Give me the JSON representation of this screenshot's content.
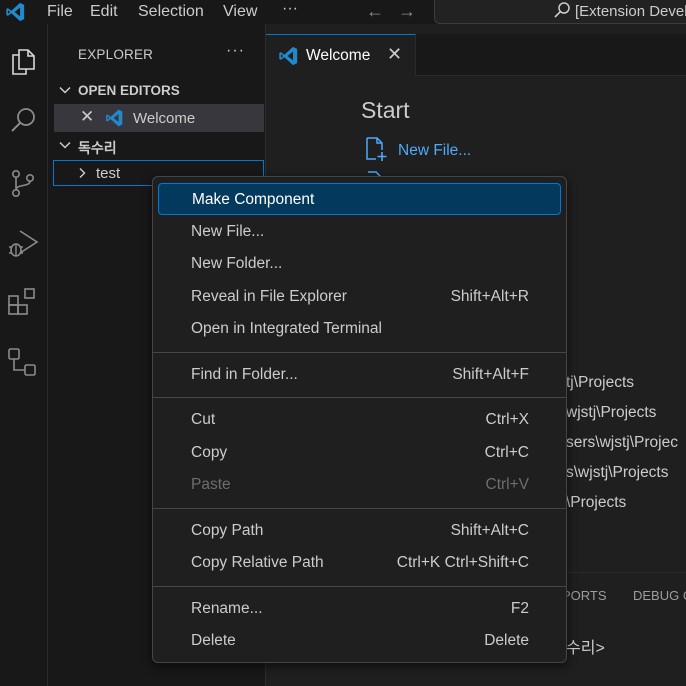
{
  "titlebar": {
    "menu": [
      "File",
      "Edit",
      "Selection",
      "View",
      "···"
    ],
    "search_text": "[Extension Develo"
  },
  "activity": [
    "explorer-icon",
    "search-icon",
    "source-control-icon",
    "run-debug-icon",
    "extensions-icon",
    "remote-explorer-icon"
  ],
  "sidebar": {
    "title": "EXPLORER",
    "more": "···",
    "open_editors_label": "OPEN EDITORS",
    "open_editor_item": "Welcome",
    "folder_label": "독수리",
    "tree_item": "test"
  },
  "editor": {
    "tab_label": "Welcome",
    "start_heading": "Start",
    "new_file_link": "New File...",
    "recent": [
      "tj\\Projects",
      "wjstj\\Projects",
      "sers\\wjstj\\Projec",
      "s\\wjstj\\Projects",
      "\\Projects"
    ],
    "panel_tabs": [
      "PORTS",
      "DEBUG C"
    ],
    "terminal_fragment": "수리>"
  },
  "context_menu": {
    "groups": [
      [
        {
          "label": "Make Component",
          "key": "",
          "active": true,
          "disabled": false
        },
        {
          "label": "New File...",
          "key": "",
          "active": false,
          "disabled": false
        },
        {
          "label": "New Folder...",
          "key": "",
          "active": false,
          "disabled": false
        },
        {
          "label": "Reveal in File Explorer",
          "key": "Shift+Alt+R",
          "active": false,
          "disabled": false
        },
        {
          "label": "Open in Integrated Terminal",
          "key": "",
          "active": false,
          "disabled": false
        }
      ],
      [
        {
          "label": "Find in Folder...",
          "key": "Shift+Alt+F",
          "active": false,
          "disabled": false
        }
      ],
      [
        {
          "label": "Cut",
          "key": "Ctrl+X",
          "active": false,
          "disabled": false
        },
        {
          "label": "Copy",
          "key": "Ctrl+C",
          "active": false,
          "disabled": false
        },
        {
          "label": "Paste",
          "key": "Ctrl+V",
          "active": false,
          "disabled": true
        }
      ],
      [
        {
          "label": "Copy Path",
          "key": "Shift+Alt+C",
          "active": false,
          "disabled": false
        },
        {
          "label": "Copy Relative Path",
          "key": "Ctrl+K Ctrl+Shift+C",
          "active": false,
          "disabled": false
        }
      ],
      [
        {
          "label": "Rename...",
          "key": "F2",
          "active": false,
          "disabled": false
        },
        {
          "label": "Delete",
          "key": "Delete",
          "active": false,
          "disabled": false
        }
      ]
    ]
  },
  "colors": {
    "accent": "#0078d4",
    "link": "#4daafc",
    "vscode_logo": "#2489ca",
    "menu_highlight": "#04395e"
  }
}
